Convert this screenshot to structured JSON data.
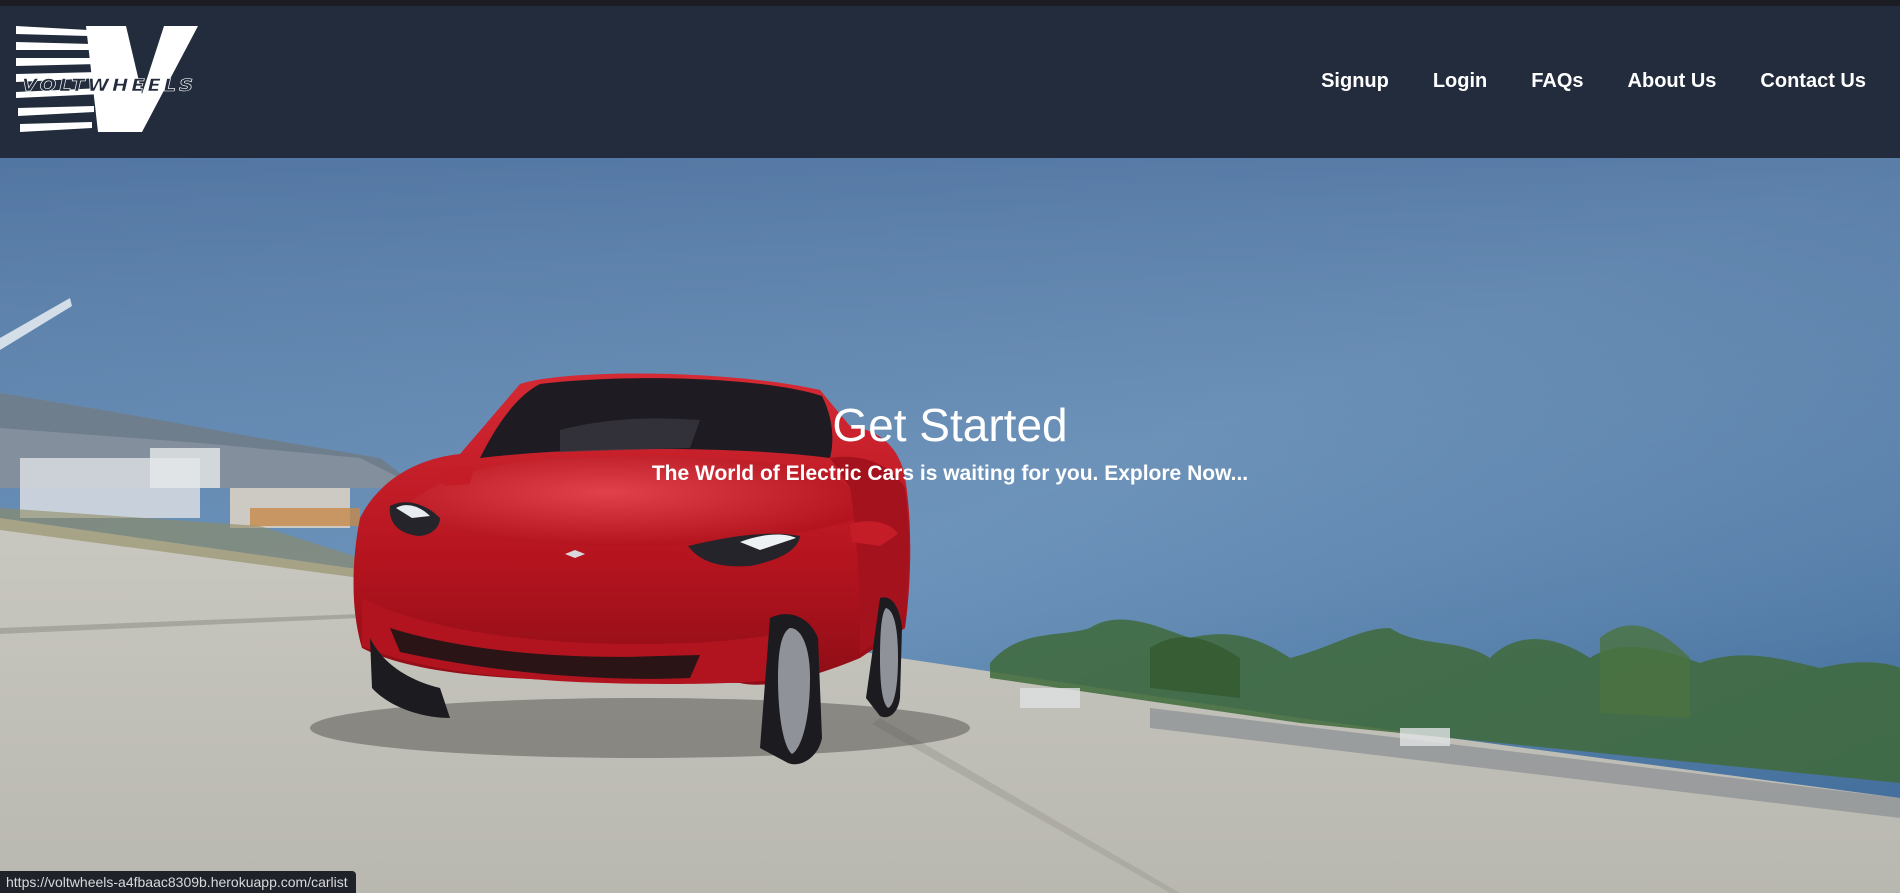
{
  "brand": {
    "logo_text": "VOLTWHEELS",
    "logo_icon": "lightning-v-logo"
  },
  "nav": {
    "items": [
      {
        "label": "Signup"
      },
      {
        "label": "Login"
      },
      {
        "label": "FAQs"
      },
      {
        "label": "About Us"
      },
      {
        "label": "Contact Us"
      }
    ]
  },
  "hero": {
    "title": "Get Started",
    "subtitle": "The World of Electric Cars is waiting for you. Explore Now...",
    "image_subject": "red electric car driving on a runway"
  },
  "status_bar": {
    "url": "https://voltwheels-a4fbaac8309b.herokuapp.com/carlist"
  },
  "colors": {
    "navbar_bg": "#222c3d",
    "text": "#ffffff",
    "sky_top": "#4d6f9c",
    "car_red": "#c91b28"
  }
}
